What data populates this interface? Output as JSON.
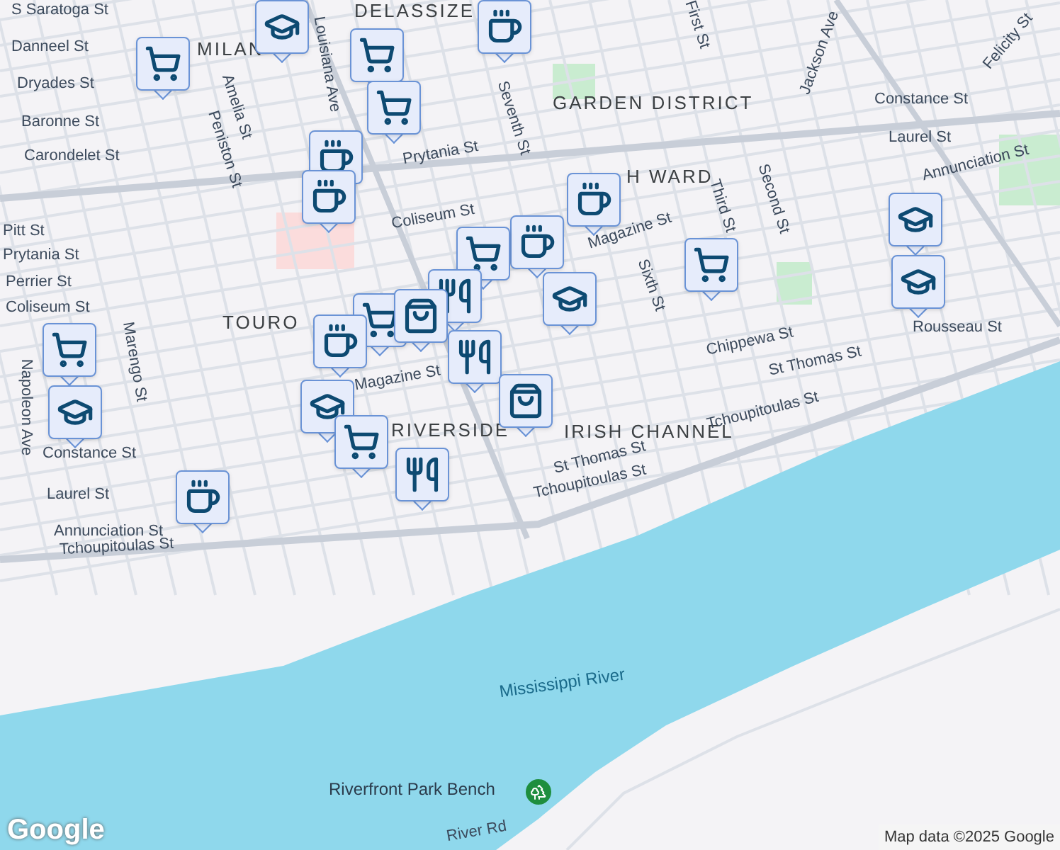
{
  "map": {
    "labels": [
      {
        "text": "DELASSIZE",
        "kind": "area"
      },
      {
        "text": "MILAN",
        "kind": "area"
      },
      {
        "text": "GARDEN DISTRICT",
        "kind": "area"
      },
      {
        "text": "H WARD",
        "kind": "area"
      },
      {
        "text": "TOURO",
        "kind": "area"
      },
      {
        "text": "RIVERSIDE",
        "kind": "area"
      },
      {
        "text": "IRISH CHANNEL",
        "kind": "area"
      },
      {
        "text": "Mississippi River",
        "kind": "water"
      },
      {
        "text": "Riverfront Park Bench",
        "kind": "poi"
      },
      {
        "text": "S Saratoga St",
        "kind": "street"
      },
      {
        "text": "Danneel St",
        "kind": "street"
      },
      {
        "text": "Dryades St",
        "kind": "street"
      },
      {
        "text": "Baronne St",
        "kind": "street"
      },
      {
        "text": "Carondelet St",
        "kind": "street"
      },
      {
        "text": "Pitt St",
        "kind": "street"
      },
      {
        "text": "Prytania St",
        "kind": "street"
      },
      {
        "text": "Perrier St",
        "kind": "street"
      },
      {
        "text": "Coliseum St",
        "kind": "street"
      },
      {
        "text": "Napoleon Ave",
        "kind": "street"
      },
      {
        "text": "Marengo St",
        "kind": "street"
      },
      {
        "text": "Amelia St",
        "kind": "street"
      },
      {
        "text": "Peniston St",
        "kind": "street"
      },
      {
        "text": "Louisiana Ave",
        "kind": "street"
      },
      {
        "text": "Prytania St",
        "kind": "street"
      },
      {
        "text": "Coliseum St",
        "kind": "street"
      },
      {
        "text": "Seventh St",
        "kind": "street"
      },
      {
        "text": "Magazine St",
        "kind": "street"
      },
      {
        "text": "Magazine St",
        "kind": "street"
      },
      {
        "text": "Constance St",
        "kind": "street"
      },
      {
        "text": "Laurel St",
        "kind": "street"
      },
      {
        "text": "Annunciation St",
        "kind": "street"
      },
      {
        "text": "Tchoupitoulas St",
        "kind": "street"
      },
      {
        "text": "Tchoupitoulas St",
        "kind": "street"
      },
      {
        "text": "Tchoupitoulas St",
        "kind": "street"
      },
      {
        "text": "Jackson Ave",
        "kind": "street"
      },
      {
        "text": "Constance St",
        "kind": "street"
      },
      {
        "text": "Laurel St",
        "kind": "street"
      },
      {
        "text": "Annunciation St",
        "kind": "street"
      },
      {
        "text": "Chippewa St",
        "kind": "street"
      },
      {
        "text": "St Thomas St",
        "kind": "street"
      },
      {
        "text": "Rousseau St",
        "kind": "street"
      },
      {
        "text": "St Thomas St",
        "kind": "street"
      },
      {
        "text": "River Rd",
        "kind": "street"
      },
      {
        "text": "Sixth St",
        "kind": "street"
      },
      {
        "text": "First St",
        "kind": "street"
      },
      {
        "text": "Second St",
        "kind": "street"
      },
      {
        "text": "Third St",
        "kind": "street"
      },
      {
        "text": "Felicity St",
        "kind": "street"
      }
    ],
    "markers": [
      {
        "kind": "cap"
      },
      {
        "kind": "cart"
      },
      {
        "kind": "cart"
      },
      {
        "kind": "cart"
      },
      {
        "kind": "coffee"
      },
      {
        "kind": "coffee"
      },
      {
        "kind": "coffee"
      },
      {
        "kind": "coffee"
      },
      {
        "kind": "coffee"
      },
      {
        "kind": "cart"
      },
      {
        "kind": "food"
      },
      {
        "kind": "cart"
      },
      {
        "kind": "bag"
      },
      {
        "kind": "coffee"
      },
      {
        "kind": "food"
      },
      {
        "kind": "bag"
      },
      {
        "kind": "cap"
      },
      {
        "kind": "cart"
      },
      {
        "kind": "cap"
      },
      {
        "kind": "cap"
      },
      {
        "kind": "cart"
      },
      {
        "kind": "cap"
      },
      {
        "kind": "cap"
      },
      {
        "kind": "cart"
      },
      {
        "kind": "food"
      },
      {
        "kind": "coffee"
      }
    ],
    "logo": "Google",
    "attribution": "Map data ©2025 Google"
  }
}
